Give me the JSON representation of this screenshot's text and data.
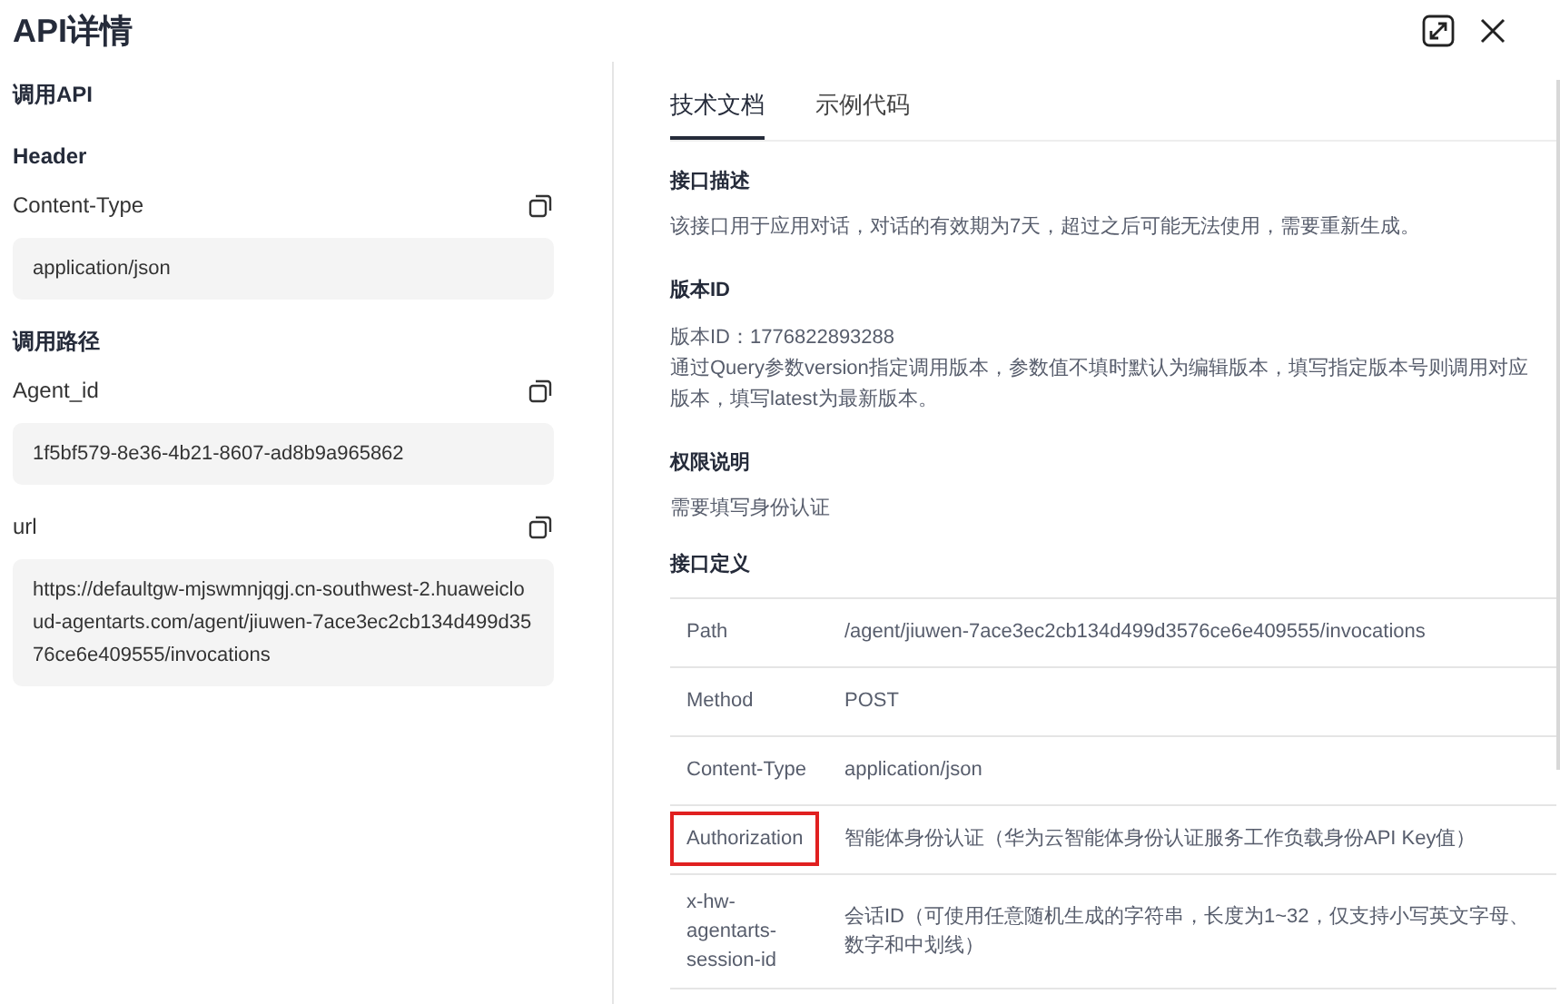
{
  "title": "API详情",
  "left": {
    "heading": "调用API",
    "groups": [
      {
        "title": "Header",
        "fields": [
          {
            "label": "Content-Type",
            "value": "application/json"
          }
        ]
      },
      {
        "title": "调用路径",
        "fields": [
          {
            "label": "Agent_id",
            "value": "1f5bf579-8e36-4b21-8607-ad8b9a965862"
          },
          {
            "label": "url",
            "value": "https://defaultgw-mjswmnjqgj.cn-southwest-2.huaweicloud-agentarts.com/agent/jiuwen-7ace3ec2cb134d499d3576ce6e409555/invocations"
          }
        ]
      }
    ]
  },
  "tabs": [
    {
      "label": "技术文档",
      "selected": true
    },
    {
      "label": "示例代码",
      "selected": false
    }
  ],
  "sections": [
    {
      "title": "接口描述",
      "lines": [
        "该接口用于应用对话，对话的有效期为7天，超过之后可能无法使用，需要重新生成。"
      ]
    },
    {
      "title": "版本ID",
      "lines": [
        "版本ID：1776822893288",
        "通过Query参数version指定调用版本，参数值不填时默认为编辑版本，填写指定版本号则调用对应版本，填写latest为最新版本。"
      ]
    },
    {
      "title": "权限说明",
      "lines": [
        "需要填写身份认证"
      ]
    }
  ],
  "definition": {
    "title": "接口定义",
    "rows": [
      {
        "name": "Path",
        "value": "/agent/jiuwen-7ace3ec2cb134d499d3576ce6e409555/invocations",
        "highlighted": false
      },
      {
        "name": "Method",
        "value": "POST",
        "highlighted": false
      },
      {
        "name": "Content-Type",
        "value": "application/json",
        "highlighted": false
      },
      {
        "name": "Authorization",
        "value": "智能体身份认证（华为云智能体身份认证服务工作负载身份API Key值）",
        "highlighted": true
      },
      {
        "name": "x-hw-agentarts-session-id",
        "value": "会话ID（可使用任意随机生成的字符串，长度为1~32，仅支持小写英文字母、数字和中划线）",
        "highlighted": false
      }
    ]
  }
}
